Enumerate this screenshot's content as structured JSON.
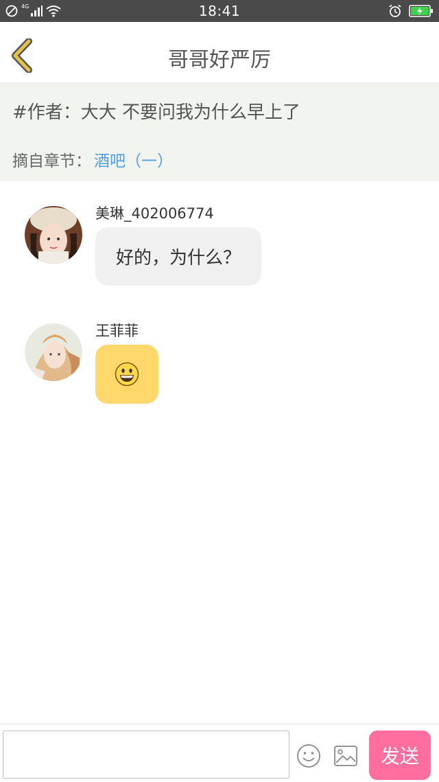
{
  "status_bar": {
    "time": "18:41",
    "network_label": "4G"
  },
  "header": {
    "title": "哥哥好严厉",
    "back_icon": "chevron-left-icon"
  },
  "info": {
    "author_line": "#作者：大大 不要问我为什么早上了",
    "chapter_prefix": "摘自章节：",
    "chapter_link": "酒吧（一）"
  },
  "messages": [
    {
      "sender": "美琳_402006774",
      "text": "好的，为什么？"
    },
    {
      "sender": "王菲菲",
      "emoji": "grinning-face-emoji"
    }
  ],
  "input_bar": {
    "placeholder": "",
    "send_label": "发送",
    "emoji_icon": "smiley-face-icon",
    "image_icon": "image-icon"
  },
  "colors": {
    "send_button": "#ff6e9e",
    "emoji_bubble": "#ffd86b",
    "chapter_link": "#4f9ee6",
    "back_icon": "#e2c34a"
  }
}
